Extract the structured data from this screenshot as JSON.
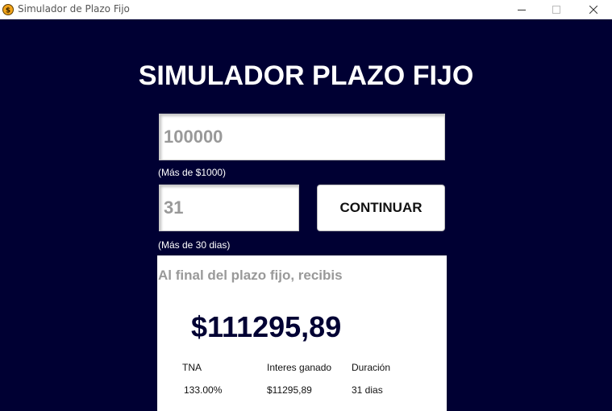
{
  "window": {
    "title": "Simulador de Plazo Fijo"
  },
  "heading": "SIMULADOR PLAZO FIJO",
  "amount_input": {
    "value": "100000",
    "hint": "(Más de $1000)"
  },
  "days_input": {
    "value": "31",
    "hint": "(Más de 30 dias)"
  },
  "continue_button": "CONTINUAR",
  "result": {
    "title": "Al final del plazo fijo, recibis",
    "amount": "$111295,89",
    "columns": [
      {
        "label": "TNA",
        "value": "133.00%"
      },
      {
        "label": "Interes ganado",
        "value": "$11295,89"
      },
      {
        "label": "Duración",
        "value": "31 dias"
      }
    ]
  },
  "colors": {
    "background": "#000033",
    "panel": "#ffffff",
    "muted_text": "#999999"
  }
}
